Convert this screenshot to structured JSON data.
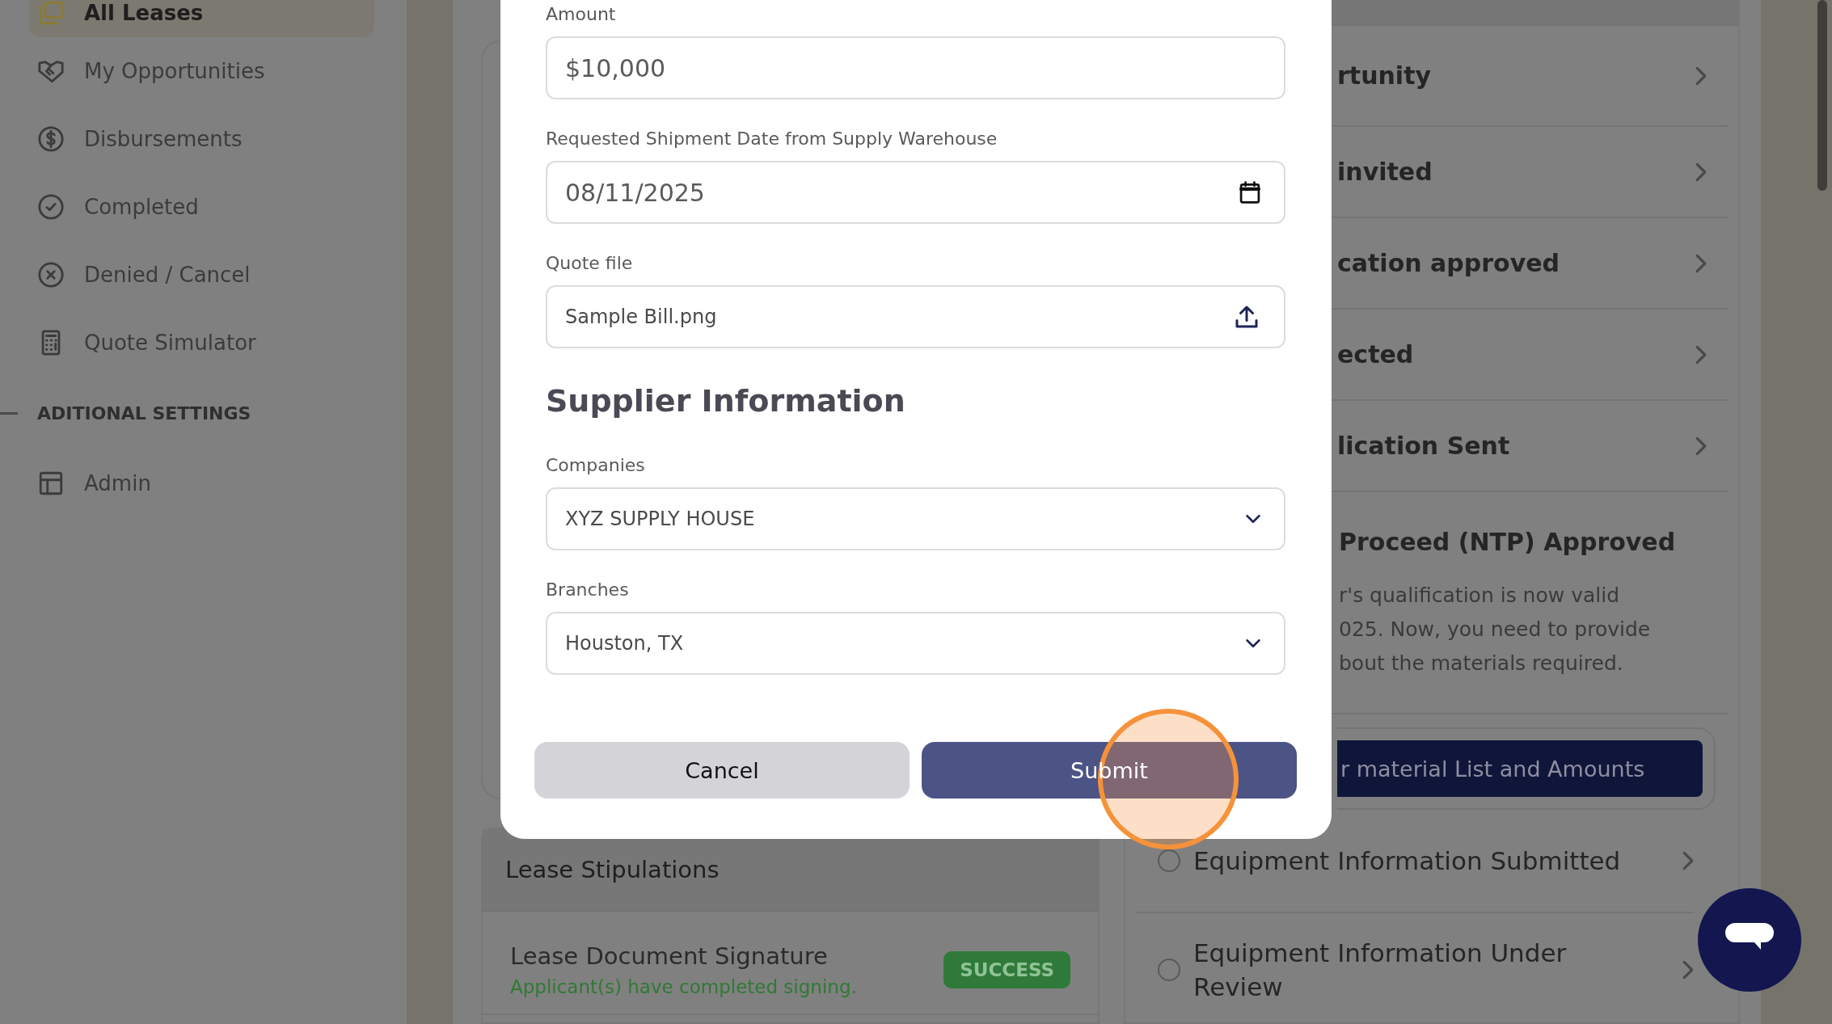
{
  "sidebar": {
    "items": [
      {
        "label": "All Leases",
        "selected": true
      },
      {
        "label": "My Opportunities",
        "selected": false
      },
      {
        "label": "Disbursements",
        "selected": false
      },
      {
        "label": "Completed",
        "selected": false
      },
      {
        "label": "Denied / Cancel",
        "selected": false
      },
      {
        "label": "Quote Simulator",
        "selected": false
      }
    ],
    "sections": [
      {
        "title": "ADITIONAL SETTINGS",
        "items": [
          {
            "label": "Admin",
            "selected": false
          }
        ]
      }
    ]
  },
  "lease_stipulations": {
    "title": "Lease Stipulations",
    "items": [
      {
        "title": "Lease Document Signature",
        "subtitle": "Applicant(s) have completed signing.",
        "status": "SUCCESS"
      }
    ]
  },
  "steps": [
    {
      "kind": "link",
      "label": "rtunity"
    },
    {
      "kind": "link",
      "label": "invited"
    },
    {
      "kind": "link",
      "label": "cation approved"
    },
    {
      "kind": "link",
      "label": "ected"
    },
    {
      "kind": "link",
      "label": "lication Sent"
    },
    {
      "kind": "detail",
      "label": "Proceed (NTP) Approved",
      "text": "r's qualification is now valid\n025. Now, you need to provide\nbout the materials required.",
      "action": "r material List and Amounts"
    },
    {
      "kind": "step",
      "label": "Equipment Information Submitted",
      "checked": false
    },
    {
      "kind": "step",
      "label": "Equipment Information Under Review",
      "checked": false
    }
  ],
  "modal": {
    "fields": [
      {
        "kind": "text",
        "label": "Amount",
        "value": "$10,000"
      },
      {
        "kind": "date",
        "label": "Requested Shipment Date from Supply Warehouse",
        "value": "08/11/2025"
      },
      {
        "kind": "file",
        "label": "Quote file",
        "value": "Sample Bill.png"
      }
    ],
    "section_title": "Supplier Information",
    "section_fields": [
      {
        "kind": "select",
        "label": "Companies",
        "value": "XYZ SUPPLY HOUSE"
      },
      {
        "kind": "select",
        "label": "Branches",
        "value": "Houston, TX"
      }
    ],
    "buttons": [
      {
        "kind": "secondary",
        "label": "Cancel"
      },
      {
        "kind": "primary",
        "label": "Submit"
      }
    ]
  }
}
